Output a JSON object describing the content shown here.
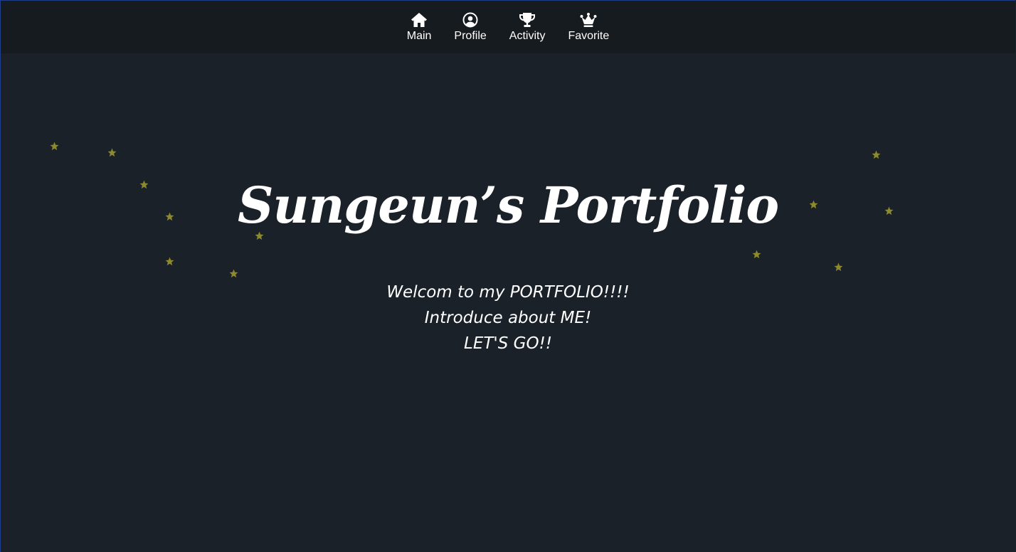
{
  "nav": {
    "items": [
      {
        "label": "Main",
        "icon": "home-icon"
      },
      {
        "label": "Profile",
        "icon": "user-circle-icon"
      },
      {
        "label": "Activity",
        "icon": "trophy-icon"
      },
      {
        "label": "Favorite",
        "icon": "crown-icon"
      }
    ]
  },
  "hero": {
    "title": "Sungeun’s Portfolio",
    "lines": [
      "Welcom to my PORTFOLIO!!!!",
      "Introduce about ME!",
      "LET'S GO!!"
    ]
  },
  "colors": {
    "background": "#1b2129",
    "navbar": "#161b1f",
    "text": "#ffffff",
    "star": "#8c8a2c"
  },
  "decorations": {
    "star_icon": "star-icon",
    "star_count": 14
  }
}
